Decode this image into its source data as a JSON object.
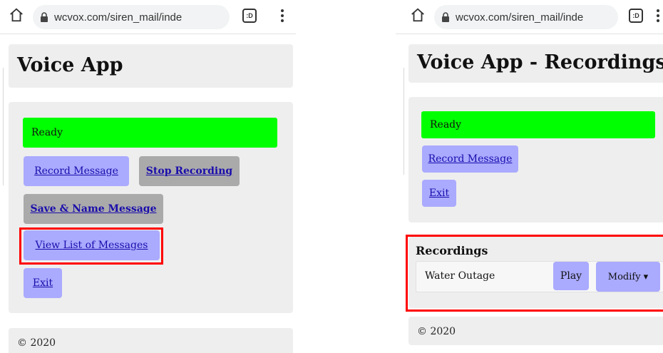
{
  "left": {
    "url": "wcvox.com/siren_mail/inde",
    "tab_count": ":D",
    "title": "Voice App",
    "status": "Ready",
    "buttons": {
      "record": "Record Message",
      "stop": "Stop Recording",
      "save": "Save & Name Message",
      "view_list": "View List of Messages",
      "exit": "Exit"
    },
    "footer": "© 2020"
  },
  "right": {
    "url": "wcvox.com/siren_mail/inde",
    "tab_count": ":D",
    "title": "Voice App - Recordings",
    "status": "Ready",
    "buttons": {
      "record": "Record Message",
      "exit": "Exit"
    },
    "recordings": {
      "heading": "Recordings",
      "items": [
        {
          "name": "Water Outage",
          "play": "Play",
          "modify": "Modify ▾"
        }
      ]
    },
    "footer": "© 2020"
  },
  "colors": {
    "status_green": "#00ff00",
    "button_blue": "#aaaaff",
    "button_gray": "#aaaaaa",
    "highlight_red": "#ff0000",
    "panel_gray": "#eeeeee"
  }
}
